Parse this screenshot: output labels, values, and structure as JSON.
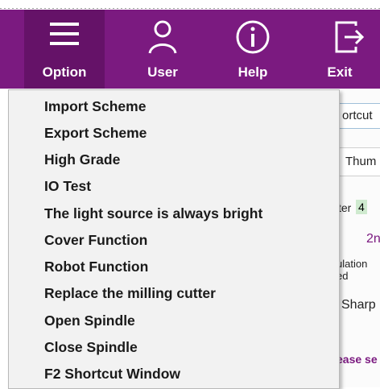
{
  "toolbar": {
    "option_label": "Option",
    "user_label": "User",
    "help_label": "Help",
    "exit_label": "Exit"
  },
  "menu": {
    "items": [
      {
        "label": "Import Scheme"
      },
      {
        "label": "Export Scheme"
      },
      {
        "label": "High Grade"
      },
      {
        "label": "IO Test"
      },
      {
        "label": "The light source is always bright"
      },
      {
        "label": "Cover Function"
      },
      {
        "label": "Robot Function"
      },
      {
        "label": "Replace the milling cutter"
      },
      {
        "label": "Open Spindle"
      },
      {
        "label": "Close Spindle"
      },
      {
        "label": "F2 Shortcut Window"
      }
    ]
  },
  "background": {
    "shortcut_tab": "ortcut",
    "thumb_tab": "Thum",
    "counter_prefix": "ter",
    "counter_value": "4",
    "purple_text": "2n",
    "simulation_text": "ulation",
    "ed_text": "ed",
    "sharp_text": "Sharp",
    "please_text": "ease se"
  },
  "colors": {
    "toolbar": "#7b1a80",
    "toolbar_active": "#651268",
    "menu_bg": "#f2f2f2"
  }
}
